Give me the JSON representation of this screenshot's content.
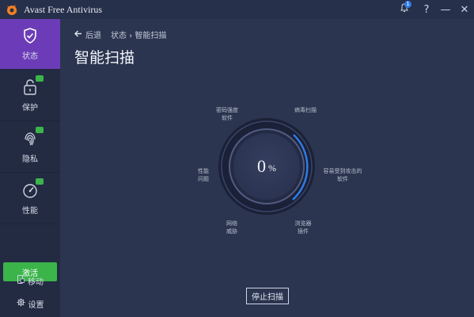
{
  "window": {
    "title": "Avast Free Antivirus",
    "notification_count": "1",
    "help_glyph": "?",
    "minimize_glyph": "—",
    "close_glyph": "✕"
  },
  "sidebar": {
    "items": [
      {
        "label": "状态",
        "icon": "shield-check-icon",
        "active": true
      },
      {
        "label": "保护",
        "icon": "lock-icon",
        "active": false
      },
      {
        "label": "隐私",
        "icon": "fingerprint-icon",
        "active": false
      },
      {
        "label": "性能",
        "icon": "speedometer-icon",
        "active": false
      }
    ],
    "activate_label": "激活",
    "mobile_label": "移动",
    "settings_label": "设置"
  },
  "breadcrumb": {
    "back_label": "后退",
    "path": "状态 › 智能扫描"
  },
  "page": {
    "title": "智能扫描"
  },
  "scan": {
    "progress": 0,
    "percent_number": "0",
    "percent_sign": "%",
    "categories": [
      {
        "label": "密码强度\n软件"
      },
      {
        "label": "病毒扫描"
      },
      {
        "label": "容易受到攻击的\n软件"
      },
      {
        "label": "浏览器\n插件"
      },
      {
        "label": "网络\n威胁"
      },
      {
        "label": "性能\n问题"
      }
    ],
    "stop_label": "停止扫描"
  },
  "colors": {
    "accent_purple": "#6c3cb8",
    "activate_green": "#3bb54a",
    "ring_blue": "#2f7be8",
    "background": "#2b3550",
    "sidebar": "#232b42"
  }
}
